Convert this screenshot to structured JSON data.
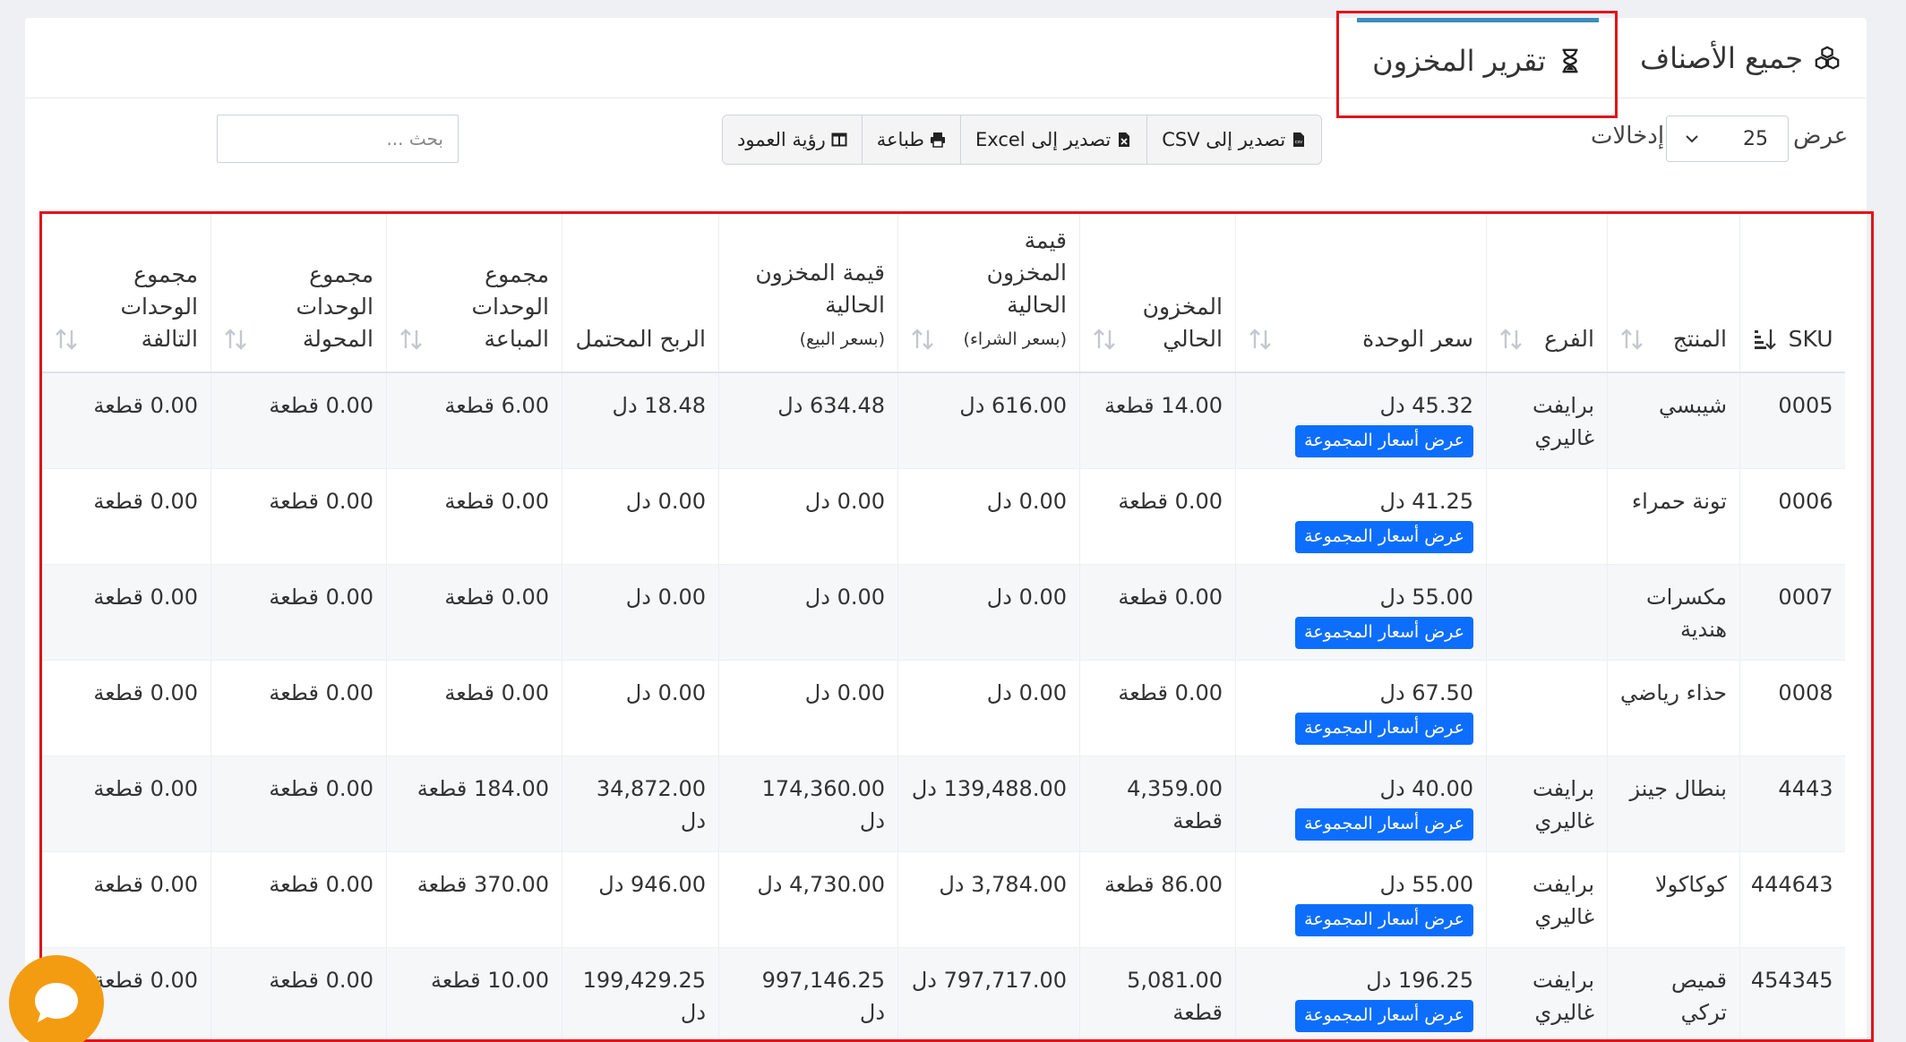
{
  "tabs": [
    {
      "label": "جميع الأصناف",
      "icon": "cubes-icon"
    },
    {
      "label": "تقرير المخزون",
      "icon": "hourglass-icon",
      "active": true
    }
  ],
  "controls": {
    "show_label": "عرض",
    "entries_label": "إدخالات",
    "page_size": "25",
    "buttons": [
      {
        "label": "تصدير إلى CSV",
        "icon": "csv-file-icon"
      },
      {
        "label": "تصدير إلى Excel",
        "icon": "excel-file-icon"
      },
      {
        "label": "طباعة",
        "icon": "print-icon"
      },
      {
        "label": "رؤية العمود",
        "icon": "columns-icon"
      }
    ],
    "search_placeholder": "بحث ..."
  },
  "table": {
    "columns": [
      {
        "label": "SKU",
        "sub": ""
      },
      {
        "label": "المنتج",
        "sub": ""
      },
      {
        "label": "الفرع",
        "sub": ""
      },
      {
        "label": "سعر الوحدة",
        "sub": ""
      },
      {
        "label": "المخزون الحالي",
        "sub": ""
      },
      {
        "label": "قيمة المخزون الحالية",
        "sub": "(بسعر الشراء)"
      },
      {
        "label": "قيمة المخزون الحالية",
        "sub": "(بسعر البيع)"
      },
      {
        "label": "الربح المحتمل",
        "sub": ""
      },
      {
        "label": "مجموع الوحدات المباعة",
        "sub": ""
      },
      {
        "label": "مجموع الوحدات المحولة",
        "sub": ""
      },
      {
        "label": "مجموع الوحدات التالفة",
        "sub": ""
      }
    ],
    "group_price_label": "عرض أسعار المجموعة",
    "rows": [
      {
        "sku": "0005",
        "product": "شيبسي",
        "branch": "برايفت غاليري",
        "unit_price": "45.32 دل",
        "stock": "14.00 قطعة",
        "value_purchase": "616.00 دل",
        "value_sale": "634.48 دل",
        "profit": "18.48 دل",
        "sold": "6.00 قطعة",
        "transferred": "0.00 قطعة",
        "damaged": "0.00 قطعة"
      },
      {
        "sku": "0006",
        "product": "تونة حمراء",
        "branch": "",
        "unit_price": "41.25 دل",
        "stock": "0.00 قطعة",
        "value_purchase": "0.00 دل",
        "value_sale": "0.00 دل",
        "profit": "0.00 دل",
        "sold": "0.00 قطعة",
        "transferred": "0.00 قطعة",
        "damaged": "0.00 قطعة"
      },
      {
        "sku": "0007",
        "product": "مكسرات هندية",
        "branch": "",
        "unit_price": "55.00 دل",
        "stock": "0.00 قطعة",
        "value_purchase": "0.00 دل",
        "value_sale": "0.00 دل",
        "profit": "0.00 دل",
        "sold": "0.00 قطعة",
        "transferred": "0.00 قطعة",
        "damaged": "0.00 قطعة"
      },
      {
        "sku": "0008",
        "product": "حذاء رياضي",
        "branch": "",
        "unit_price": "67.50 دل",
        "stock": "0.00 قطعة",
        "value_purchase": "0.00 دل",
        "value_sale": "0.00 دل",
        "profit": "0.00 دل",
        "sold": "0.00 قطعة",
        "transferred": "0.00 قطعة",
        "damaged": "0.00 قطعة"
      },
      {
        "sku": "4443",
        "product": "بنطال جينز",
        "branch": "برايفت غاليري",
        "unit_price": "40.00 دل",
        "stock": "4,359.00 قطعة",
        "value_purchase": "139,488.00 دل",
        "value_sale": "174,360.00 دل",
        "profit": "34,872.00 دل",
        "sold": "184.00 قطعة",
        "transferred": "0.00 قطعة",
        "damaged": "0.00 قطعة"
      },
      {
        "sku": "444643",
        "product": "كوكاكولا",
        "branch": "برايفت غاليري",
        "unit_price": "55.00 دل",
        "stock": "86.00 قطعة",
        "value_purchase": "3,784.00 دل",
        "value_sale": "4,730.00 دل",
        "profit": "946.00 دل",
        "sold": "370.00 قطعة",
        "transferred": "0.00 قطعة",
        "damaged": "0.00 قطعة"
      },
      {
        "sku": "454345",
        "product": "قميص تركي",
        "branch": "برايفت غاليري",
        "unit_price": "196.25 دل",
        "stock": "5,081.00 قطعة",
        "value_purchase": "797,717.00 دل",
        "value_sale": "997,146.25 دل",
        "profit": "199,429.25 دل",
        "sold": "10.00 قطعة",
        "transferred": "0.00 قطعة",
        "damaged": "0.00 قطعة"
      }
    ]
  },
  "colors": {
    "accent": "#0d6efd",
    "tab_active": "#3c8dbc",
    "highlight_frame": "#e0141b",
    "chat": "#f39c12"
  }
}
